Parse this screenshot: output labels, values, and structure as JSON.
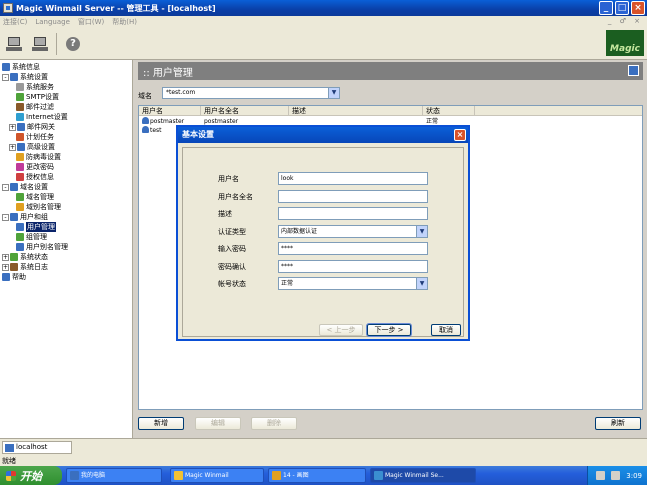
{
  "window": {
    "title": "Magic Winmail Server -- 管理工具 - [localhost]",
    "minimize": "_",
    "maximize": "□",
    "close": "×"
  },
  "menu": [
    "连接(C)",
    "Language",
    "窗口(W)",
    "帮助(H)"
  ],
  "mdi_controls": "_ ♂ ×",
  "logo_text": "Magic",
  "tree": [
    {
      "label": "系统信息",
      "level": 0,
      "exp": "",
      "color": "#3a6fbf"
    },
    {
      "label": "系统设置",
      "level": 0,
      "exp": "-",
      "color": "#3a6fbf"
    },
    {
      "label": "系统服务",
      "level": 2,
      "exp": "",
      "color": "#9a9a9a"
    },
    {
      "label": "SMTP设置",
      "level": 2,
      "exp": "",
      "color": "#4fa33a"
    },
    {
      "label": "邮件过滤",
      "level": 2,
      "exp": "",
      "color": "#8a5a2a"
    },
    {
      "label": "Internet设置",
      "level": 2,
      "exp": "",
      "color": "#2f9fd0"
    },
    {
      "label": "邮件网关",
      "level": 1,
      "exp": "+",
      "color": "#3a6fbf"
    },
    {
      "label": "计划任务",
      "level": 2,
      "exp": "",
      "color": "#d0552a"
    },
    {
      "label": "高级设置",
      "level": 1,
      "exp": "+",
      "color": "#3a6fbf"
    },
    {
      "label": "防病毒设置",
      "level": 2,
      "exp": "",
      "color": "#e0a020"
    },
    {
      "label": "更改密码",
      "level": 2,
      "exp": "",
      "color": "#c03a9a"
    },
    {
      "label": "授权信息",
      "level": 2,
      "exp": "",
      "color": "#d04040"
    },
    {
      "label": "域名设置",
      "level": 0,
      "exp": "-",
      "color": "#3a6fbf"
    },
    {
      "label": "域名管理",
      "level": 2,
      "exp": "",
      "color": "#4fa33a"
    },
    {
      "label": "域别名管理",
      "level": 2,
      "exp": "",
      "color": "#e0a020"
    },
    {
      "label": "用户和组",
      "level": 0,
      "exp": "-",
      "color": "#3a6fbf"
    },
    {
      "label": "用户管理",
      "level": 2,
      "exp": "",
      "color": "#3a6fbf",
      "selected": true
    },
    {
      "label": "组管理",
      "level": 2,
      "exp": "",
      "color": "#4fa33a"
    },
    {
      "label": "用户别名管理",
      "level": 2,
      "exp": "",
      "color": "#3a6fbf"
    },
    {
      "label": "系统状态",
      "level": 0,
      "exp": "+",
      "color": "#4fa33a"
    },
    {
      "label": "系统日志",
      "level": 0,
      "exp": "+",
      "color": "#8a5a2a"
    },
    {
      "label": "帮助",
      "level": 0,
      "exp": "",
      "color": "#3a6fbf"
    }
  ],
  "panel": {
    "title": ":: 用户管理",
    "domain_label": "域名",
    "domain_value": "*test.com",
    "columns": [
      "用户名",
      "用户名全名",
      "描述",
      "状态"
    ],
    "rows": [
      {
        "user": "postmaster",
        "full": "postmaster",
        "desc": "",
        "status": "正常"
      },
      {
        "user": "test",
        "full": "",
        "desc": "",
        "status": ""
      }
    ],
    "add": "新增",
    "edit": "编辑",
    "delete": "删除",
    "refresh": "刷新"
  },
  "dialog": {
    "title": "基本设置",
    "close": "×",
    "fields": [
      {
        "label": "用户名",
        "value": "look"
      },
      {
        "label": "用户名全名",
        "value": ""
      },
      {
        "label": "描述",
        "value": ""
      },
      {
        "label": "认证类型",
        "value": "内部数据认证",
        "select": true
      },
      {
        "label": "输入密码",
        "value": "****"
      },
      {
        "label": "密码确认",
        "value": "****"
      },
      {
        "label": "帐号状态",
        "value": "正常",
        "select": true
      }
    ],
    "prev": "< 上一步",
    "next": "下一步 >",
    "cancel": "取消"
  },
  "status": {
    "host": "localhost",
    "ready": "就绪"
  },
  "taskbar": {
    "start": "开始",
    "tasks": [
      {
        "label": "我的电脑",
        "color": "#3a6fbf"
      },
      {
        "label": "Magic Winmail",
        "color": "#f2c233"
      },
      {
        "label": "14 - 画图",
        "color": "#e0a020"
      },
      {
        "label": "Magic Winmail Se...",
        "color": "#3a8fd0",
        "active": true
      }
    ],
    "clock": "3:09"
  }
}
